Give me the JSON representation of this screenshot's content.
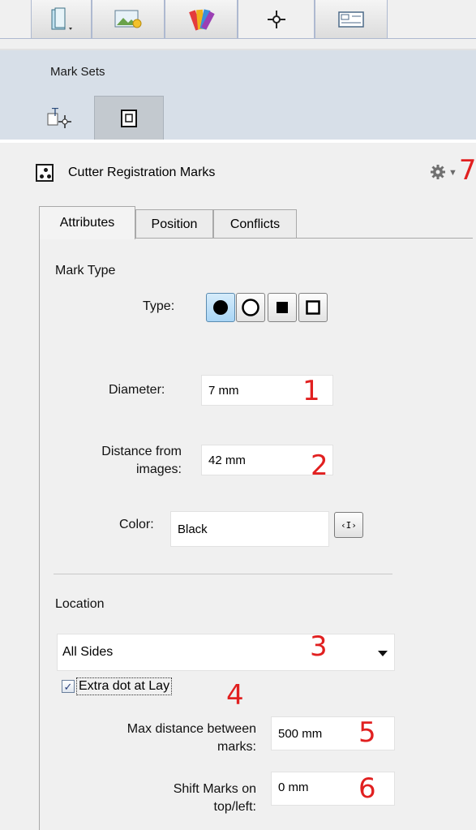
{
  "toolbar": {
    "tabs": [
      {
        "icon": "book-icon"
      },
      {
        "icon": "image-icon"
      },
      {
        "icon": "color-swatch-icon"
      },
      {
        "icon": "crosshair-mark-icon"
      },
      {
        "icon": "layout-icon"
      }
    ]
  },
  "marksets": {
    "title": "Mark Sets",
    "buttons": [
      {
        "icon": "text-mark-icon"
      },
      {
        "icon": "page-icon"
      }
    ]
  },
  "mark": {
    "title": "Cutter Registration Marks",
    "menu_icon": "gear-icon"
  },
  "tabs": [
    "Attributes",
    "Position",
    "Conflicts"
  ],
  "mark_type": {
    "heading": "Mark Type",
    "type_label": "Type:",
    "types": [
      "filled-circle",
      "hollow-circle",
      "filled-square",
      "hollow-square"
    ],
    "selected": "filled-circle"
  },
  "diameter": {
    "label": "Diameter:",
    "value": "7 mm"
  },
  "distance": {
    "label_line1": "Distance from",
    "label_line2": "images:",
    "value": "42 mm"
  },
  "color": {
    "label": "Color:",
    "value": "Black",
    "button_label": "‹I›"
  },
  "location": {
    "heading": "Location",
    "selected": "All Sides",
    "extra_dot": {
      "checked": true,
      "label": "Extra dot at Lay"
    },
    "max_distance": {
      "label_line1": "Max distance between",
      "label_line2": "marks:",
      "value": "500 mm"
    },
    "shift_marks": {
      "label_line1": "Shift Marks on",
      "label_line2": "top/left:",
      "value": "0 mm"
    }
  },
  "callouts": [
    "1",
    "2",
    "3",
    "4",
    "5",
    "6",
    "7"
  ],
  "colors": {
    "callout": "#e12020",
    "header_bg": "#d7dfe8",
    "selected_type": "#a9d5f5"
  }
}
